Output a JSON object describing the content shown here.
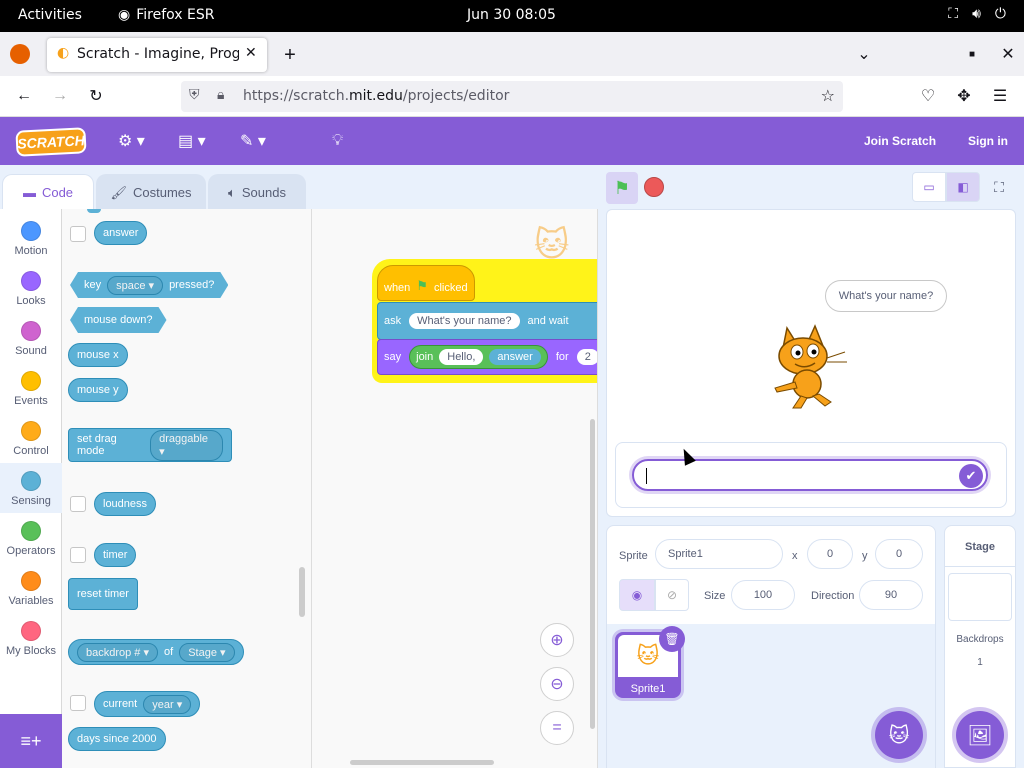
{
  "gnome": {
    "activities": "Activities",
    "app": "Firefox ESR",
    "clock": "Jun 30  08:05"
  },
  "firefox": {
    "tab_title": "Scratch - Imagine, Program",
    "url_prefix": "https://scratch.",
    "url_domain": "mit.edu",
    "url_path": "/projects/editor"
  },
  "scratch_menu": {
    "logo": "SCRATCH",
    "join": "Join Scratch",
    "signin": "Sign in"
  },
  "editor_tabs": {
    "code": "Code",
    "costumes": "Costumes",
    "sounds": "Sounds"
  },
  "categories": [
    {
      "label": "Motion",
      "color": "#4c97ff"
    },
    {
      "label": "Looks",
      "color": "#9966ff"
    },
    {
      "label": "Sound",
      "color": "#cf63cf"
    },
    {
      "label": "Events",
      "color": "#ffbf00"
    },
    {
      "label": "Control",
      "color": "#ffab19"
    },
    {
      "label": "Sensing",
      "color": "#5cb1d6"
    },
    {
      "label": "Operators",
      "color": "#59c059"
    },
    {
      "label": "Variables",
      "color": "#ff8c1a"
    },
    {
      "label": "My Blocks",
      "color": "#ff6680"
    }
  ],
  "palette": {
    "answer": "answer",
    "key_prefix": "key",
    "key_value": "space",
    "key_suffix": "pressed?",
    "mouse_down": "mouse down?",
    "mouse_x": "mouse x",
    "mouse_y": "mouse y",
    "set_drag": "set drag mode",
    "drag_value": "draggable",
    "loudness": "loudness",
    "timer": "timer",
    "reset_timer": "reset timer",
    "backdrop_value": "backdrop #",
    "of": "of",
    "stage_value": "Stage",
    "current": "current",
    "current_value": "year",
    "days_since": "days since 2000"
  },
  "script": {
    "when": "when",
    "clicked": "clicked",
    "ask": "ask",
    "ask_value": "What's your name?",
    "and_wait": "and wait",
    "say": "say",
    "join": "join",
    "hello": "Hello,",
    "answer": "answer",
    "for": "for",
    "secs": "2"
  },
  "stage": {
    "speech": "What's your name?"
  },
  "sprite_info": {
    "sprite_label": "Sprite",
    "sprite_name": "Sprite1",
    "x_label": "x",
    "x_value": "0",
    "y_label": "y",
    "y_value": "0",
    "size_label": "Size",
    "size_value": "100",
    "direction_label": "Direction",
    "direction_value": "90",
    "thumb_name": "Sprite1"
  },
  "stage_pane": {
    "title": "Stage",
    "backdrops_label": "Backdrops",
    "backdrops_count": "1"
  }
}
